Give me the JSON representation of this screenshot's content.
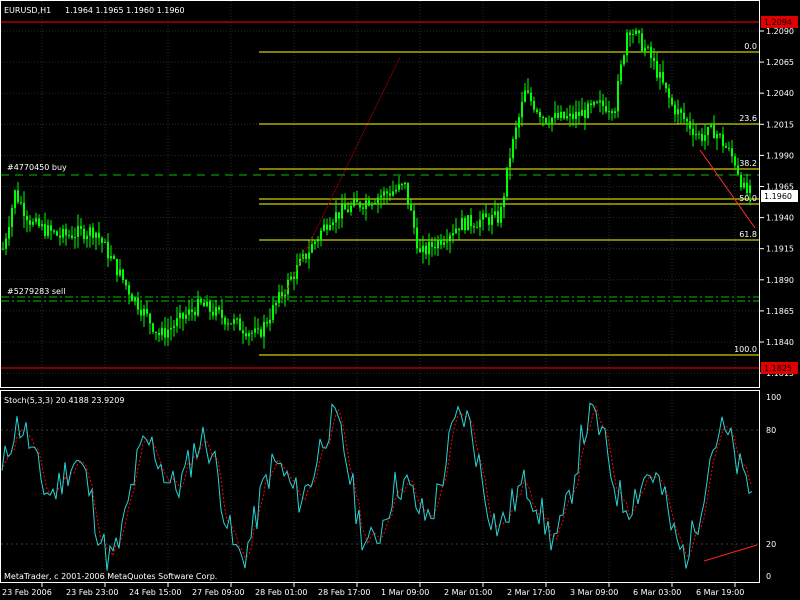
{
  "header": {
    "symbol_tf": "EURUSD,H1",
    "ohlc": "1.1964 1.1965 1.1960 1.1960"
  },
  "price_axis": {
    "ticks": [
      "1.2090",
      "1.2065",
      "1.2040",
      "1.2015",
      "1.1990",
      "1.1965",
      "1.1940",
      "1.1915",
      "1.1890",
      "1.1865",
      "1.1840",
      "1.1815"
    ],
    "high_label": "1.2094",
    "low_label": "1.1825",
    "current_label": "1.1960"
  },
  "fib_labels": [
    "0.0",
    "23.6",
    "38.2",
    "50.0",
    "61.8",
    "100.0"
  ],
  "orders": {
    "buy": "#4770450 buy",
    "sell": "#5279283 sell"
  },
  "stoch": {
    "title": "Stoch(5,3,3) 20.4188 23.9209",
    "levels": [
      "100",
      "80",
      "20",
      "0"
    ]
  },
  "time_axis": [
    "23 Feb 2006",
    "23 Feb 23:00",
    "24 Feb 15:00",
    "27 Feb 09:00",
    "28 Feb 01:00",
    "28 Feb 17:00",
    "1 Mar 09:00",
    "2 Mar 01:00",
    "2 Mar 17:00",
    "3 Mar 09:00",
    "6 Mar 03:00",
    "6 Mar 19:00"
  ],
  "copyright": "MetaTrader, c 2001-2006 MetaQuotes Software Corp.",
  "colors": {
    "candle": "#00ff00",
    "grid": "#2a2a2a",
    "fib": "#ffff00",
    "hline_red": "#ff0000",
    "order_line": "#00c000",
    "stoch_main": "#28d4d4",
    "stoch_signal": "#ff0000",
    "badge_red": "#e00000"
  }
}
